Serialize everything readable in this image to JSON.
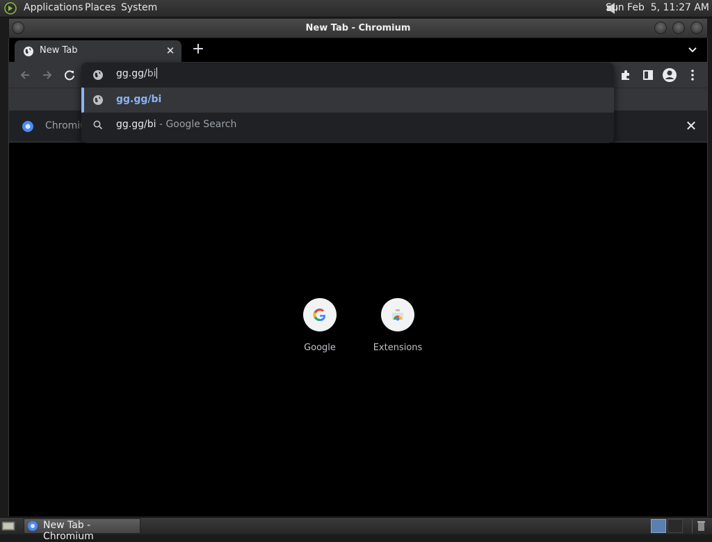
{
  "top_panel": {
    "menus": [
      "Applications",
      "Places",
      "System"
    ],
    "clock": "Sun Feb  5, 11:27 AM"
  },
  "window": {
    "title": "New Tab - Chromium"
  },
  "tabs": [
    {
      "title": "New Tab",
      "active": true
    }
  ],
  "omnibox": {
    "typed": "gg.gg/",
    "autocompleted": "bi",
    "suggestions": [
      {
        "icon": "globe-icon",
        "text": "gg.gg/bi",
        "sub": ""
      },
      {
        "icon": "search-icon",
        "text": "gg.gg/bi",
        "sub": " - Google Search"
      }
    ]
  },
  "infobar": {
    "text": "Chromiu"
  },
  "shortcuts": [
    {
      "label": "Google",
      "icon": "google-g-icon"
    },
    {
      "label": "Extensions",
      "icon": "chrome-web-store-icon"
    }
  ],
  "taskbar": {
    "task_label": "New Tab - Chromium"
  },
  "colors": {
    "accent": "#8ab4f8",
    "toolbar": "#35363a",
    "omnibox_bg": "#202124"
  }
}
